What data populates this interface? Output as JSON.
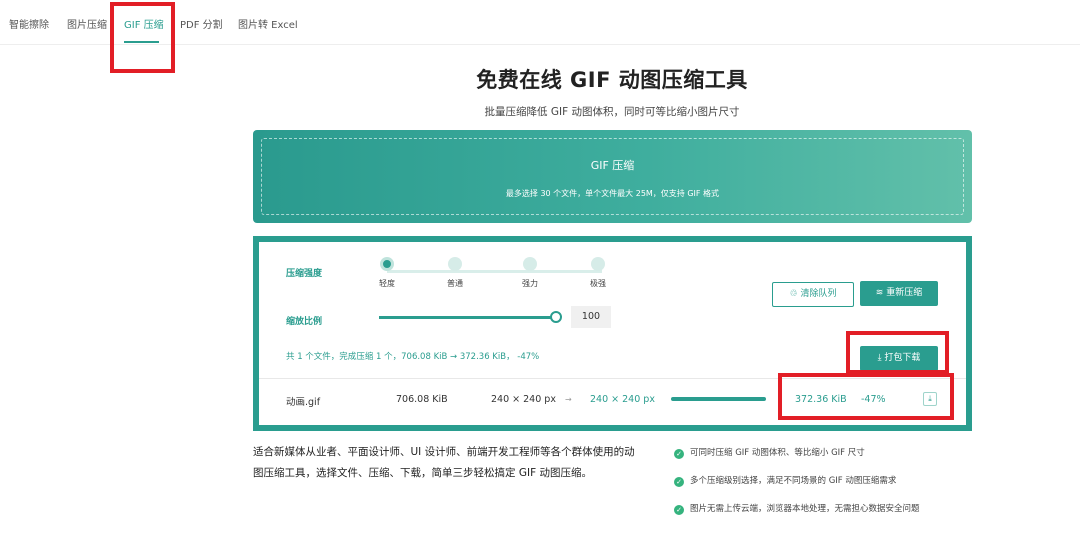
{
  "nav": {
    "items": [
      {
        "label": "智能擦除"
      },
      {
        "label": "图片压缩"
      },
      {
        "label": "GIF 压缩"
      },
      {
        "label": "PDF 分割"
      },
      {
        "label": "图片转 Excel"
      }
    ],
    "active": "GIF 压缩"
  },
  "header": {
    "title": "免费在线 GIF 动图压缩工具",
    "subtitle": "批量压缩降低 GIF 动图体积，同时可等比缩小图片尺寸"
  },
  "upload": {
    "title": "GIF 压缩",
    "description": "最多选择 30 个文件，单个文件最大 25M，仅支持 GIF 格式"
  },
  "settings": {
    "strength_label": "压缩强度",
    "strength_options": [
      "轻度",
      "普通",
      "强力",
      "极强"
    ],
    "strength_selected": "轻度",
    "scale_label": "缩放比例",
    "scale_value": "100",
    "scale_fraction": 1.0,
    "clear_button": "清除队列",
    "recompress_button": "重新压缩",
    "download_all_button": "打包下载",
    "summary": "共 1 个文件，完成压缩 1 个，706.08 KiB → 372.36 KiB， -47%"
  },
  "files": [
    {
      "name": "动画.gif",
      "original_size": "706.08 KiB",
      "original_dims": "240 × 240 px",
      "new_dims": "240 × 240 px",
      "progress": 1.0,
      "new_size": "372.36 KiB",
      "ratio": "-47%"
    }
  ],
  "description": "适合新媒体从业者、平面设计师、UI 设计师、前端开发工程师等各个群体使用的动图压缩工具，选择文件、压缩、下载，简单三步轻松搞定 GIF 动图压缩。",
  "features": [
    "可同时压缩 GIF 动图体积、等比缩小 GIF 尺寸",
    "多个压缩级别选择，满足不同场景的 GIF 动图压缩需求",
    "图片无需上传云端，浏览器本地处理，无需担心数据安全问题"
  ],
  "colors": {
    "accent": "#2a9d8f",
    "highlight_box": "#e21e26",
    "check": "#35b37e"
  }
}
